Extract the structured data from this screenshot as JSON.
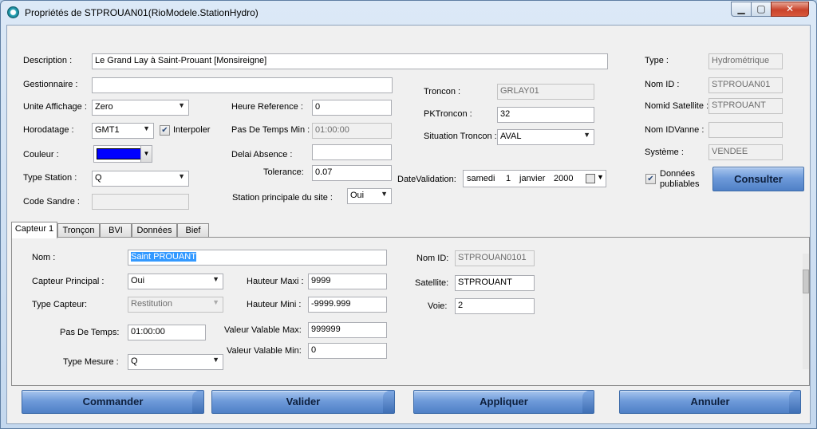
{
  "window": {
    "title": "Propriétés de STPROUAN01(RioModele.StationHydro)"
  },
  "form": {
    "description_label": "Description :",
    "description_value": "Le Grand Lay à Saint-Prouant [Monsireigne]",
    "gestionnaire_label": "Gestionnaire :",
    "gestionnaire_value": "",
    "unite_label": "Unite Affichage :",
    "unite_value": "Zero",
    "horodatage_label": "Horodatage :",
    "horodatage_value": "GMT1",
    "interpoler_label": "Interpoler",
    "interpoler_checked": true,
    "couleur_label": "Couleur :",
    "couleur_color": "#0000ff",
    "type_station_label": "Type Station :",
    "type_station_value": "Q",
    "code_sandre_label": "Code Sandre :",
    "code_sandre_value": "",
    "heure_ref_label": "Heure Reference :",
    "heure_ref_value": "0",
    "pas_temps_min_label": "Pas De Temps Min :",
    "pas_temps_min_value": "01:00:00",
    "delai_absence_label": "Delai Absence :",
    "delai_absence_value": "",
    "tolerance_label": "Tolerance:",
    "tolerance_value": "0.07",
    "station_principale_label": "Station principale du site :",
    "station_principale_value": "Oui",
    "troncon_label": "Troncon :",
    "troncon_value": "GRLAY01",
    "pktroncon_label": "PKTroncon :",
    "pktroncon_value": "32",
    "situation_troncon_label": "Situation Troncon :",
    "situation_troncon_value": "AVAL",
    "datevalidation_label": "DateValidation:",
    "date_day_name": "samedi",
    "date_day": "1",
    "date_month": "janvier",
    "date_year": "2000",
    "type_label": "Type :",
    "type_value": "Hydrométrique",
    "nom_id_label": "Nom ID :",
    "nom_id_value": "STPROUAN01",
    "nomid_satellite_label": "Nomid Satellite :",
    "nomid_satellite_value": "STPROUANT",
    "nom_idvanne_label": "Nom IDVanne :",
    "nom_idvanne_value": "",
    "systeme_label": "Système :",
    "systeme_value": "VENDEE",
    "donnees_publiables_label_1": "Données",
    "donnees_publiables_label_2": "publiables",
    "donnees_publiables_checked": true,
    "consulter_label": "Consulter"
  },
  "tabs": [
    {
      "label": "Capteur 1",
      "active": true
    },
    {
      "label": "Tronçon"
    },
    {
      "label": "BVI"
    },
    {
      "label": "Données"
    },
    {
      "label": "Bief"
    }
  ],
  "capteur": {
    "nom_label": "Nom :",
    "nom_value": "Saint PROUANT",
    "capteur_principal_label": "Capteur Principal :",
    "capteur_principal_value": "Oui",
    "type_capteur_label": "Type Capteur:",
    "type_capteur_value": "Restitution",
    "pas_de_temps_label": "Pas De Temps:",
    "pas_de_temps_value": "01:00:00",
    "type_mesure_label": "Type Mesure :",
    "type_mesure_value": "Q",
    "hauteur_maxi_label": "Hauteur Maxi :",
    "hauteur_maxi_value": "9999",
    "hauteur_mini_label": "Hauteur Mini :",
    "hauteur_mini_value": "-9999.999",
    "valeur_valable_max_label": "Valeur Valable Max:",
    "valeur_valable_max_value": "999999",
    "valeur_valable_min_label": "Valeur Valable Min:",
    "valeur_valable_min_value": "0",
    "nom_id_label": "Nom ID:",
    "nom_id_value": "STPROUAN0101",
    "satellite_label": "Satellite:",
    "satellite_value": "STPROUANT",
    "voie_label": "Voie:",
    "voie_value": "2"
  },
  "buttons": {
    "commander": "Commander",
    "valider": "Valider",
    "appliquer": "Appliquer",
    "annuler": "Annuler"
  }
}
